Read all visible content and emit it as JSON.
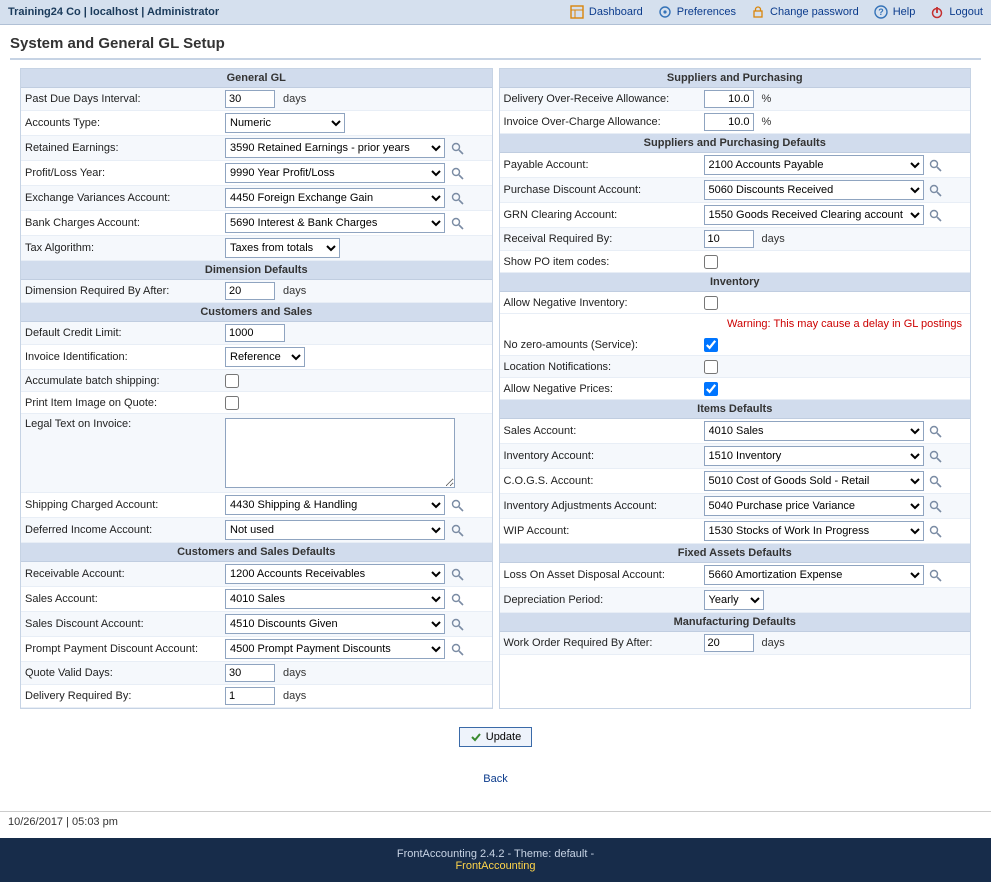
{
  "top": {
    "left": "Training24 Co | localhost | Administrator",
    "links": {
      "dashboard": "Dashboard",
      "preferences": "Preferences",
      "changepw": "Change password",
      "help": "Help",
      "logout": "Logout"
    }
  },
  "title": "System and General GL Setup",
  "u": {
    "days": "days",
    "pct": "%"
  },
  "left": {
    "s1": {
      "h": "General GL",
      "past_due_lbl": "Past Due Days Interval:",
      "past_due_val": "30",
      "accounts_type_lbl": "Accounts Type:",
      "accounts_type_val": "Numeric",
      "retained_lbl": "Retained Earnings:",
      "retained_val": "3590   Retained Earnings - prior years",
      "pl_year_lbl": "Profit/Loss Year:",
      "pl_year_val": "9990   Year Profit/Loss",
      "exvar_lbl": "Exchange Variances Account:",
      "exvar_val": "4450   Foreign Exchange Gain",
      "bankchg_lbl": "Bank Charges Account:",
      "bankchg_val": "5690   Interest & Bank Charges",
      "tax_lbl": "Tax Algorithm:",
      "tax_val": "Taxes from totals"
    },
    "s2": {
      "h": "Dimension Defaults",
      "dimreq_lbl": "Dimension Required By After:",
      "dimreq_val": "20"
    },
    "s3": {
      "h": "Customers and Sales",
      "credit_lbl": "Default Credit Limit:",
      "credit_val": "1000",
      "invid_lbl": "Invoice Identification:",
      "invid_val": "Reference",
      "accum_lbl": "Accumulate batch shipping:",
      "printimg_lbl": "Print Item Image on Quote:",
      "legal_lbl": "Legal Text on Invoice:",
      "legal_val": "",
      "shipchg_lbl": "Shipping Charged Account:",
      "shipchg_val": "4430   Shipping & Handling",
      "definc_lbl": "Deferred Income Account:",
      "definc_val": "Not used"
    },
    "s4": {
      "h": "Customers and Sales Defaults",
      "recv_lbl": "Receivable Account:",
      "recv_val": "1200   Accounts Receivables",
      "sales_lbl": "Sales Account:",
      "sales_val": "4010   Sales",
      "sdisc_lbl": "Sales Discount Account:",
      "sdisc_val": "4510   Discounts Given",
      "ppd_lbl": "Prompt Payment Discount Account:",
      "ppd_val": "4500   Prompt Payment Discounts",
      "quote_lbl": "Quote Valid Days:",
      "quote_val": "30",
      "delreq_lbl": "Delivery Required By:",
      "delreq_val": "1"
    }
  },
  "right": {
    "s1": {
      "h": "Suppliers and Purchasing",
      "over_recv_lbl": "Delivery Over-Receive Allowance:",
      "over_recv_val": "10.0",
      "over_chg_lbl": "Invoice Over-Charge Allowance:",
      "over_chg_val": "10.0"
    },
    "s2": {
      "h": "Suppliers and Purchasing Defaults",
      "payable_lbl": "Payable Account:",
      "payable_val": "2100   Accounts Payable",
      "pdisc_lbl": "Purchase Discount Account:",
      "pdisc_val": "5060   Discounts Received",
      "grn_lbl": "GRN Clearing Account:",
      "grn_val": "1550   Goods Received Clearing account",
      "recvby_lbl": "Receival Required By:",
      "recvby_val": "10",
      "showpo_lbl": "Show PO item codes:"
    },
    "s3": {
      "h": "Inventory",
      "neginv_lbl": "Allow Negative Inventory:",
      "warn": "Warning: This may cause a delay in GL postings",
      "nozero_lbl": "No zero-amounts (Service):",
      "locnot_lbl": "Location Notifications:",
      "negprice_lbl": "Allow Negative Prices:"
    },
    "s4": {
      "h": "Items Defaults",
      "sales_lbl": "Sales Account:",
      "sales_val": "4010   Sales",
      "inv_lbl": "Inventory Account:",
      "inv_val": "1510   Inventory",
      "cogs_lbl": "C.O.G.S. Account:",
      "cogs_val": "5010   Cost of Goods Sold - Retail",
      "invadj_lbl": "Inventory Adjustments Account:",
      "invadj_val": "5040   Purchase price Variance",
      "wip_lbl": "WIP Account:",
      "wip_val": "1530   Stocks of Work In Progress"
    },
    "s5": {
      "h": "Fixed Assets Defaults",
      "loss_lbl": "Loss On Asset Disposal Account:",
      "loss_val": "5660   Amortization Expense",
      "deprec_lbl": "Depreciation Period:",
      "deprec_val": "Yearly"
    },
    "s6": {
      "h": "Manufacturing Defaults",
      "wo_lbl": "Work Order Required By After:",
      "wo_val": "20"
    }
  },
  "btn_update": "Update",
  "back_link": "Back",
  "datetime": "10/26/2017 | 05:03 pm",
  "footer_text": "FrontAccounting 2.4.2 - Theme: default -",
  "footer_link": "FrontAccounting"
}
